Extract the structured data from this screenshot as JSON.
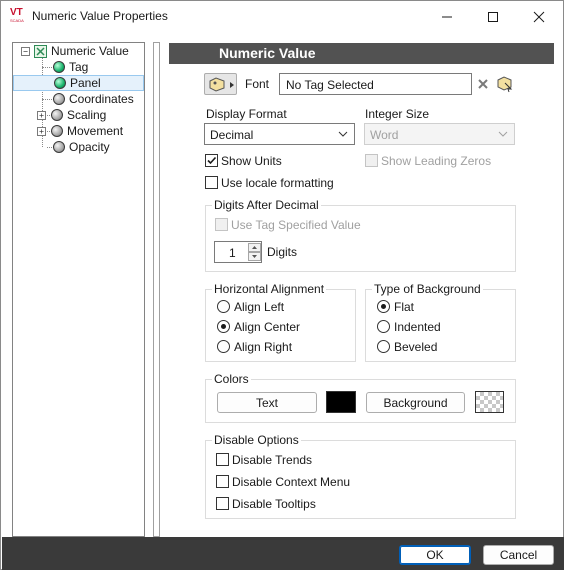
{
  "window": {
    "title": "Numeric Value Properties",
    "logo_text": "VT",
    "logo_subtext": "SCADA"
  },
  "tree": {
    "items": [
      {
        "label": "Numeric Value",
        "icon": "root-properties-icon",
        "expandable": true
      },
      {
        "label": "Tag",
        "icon": "green-ball-icon"
      },
      {
        "label": "Panel",
        "icon": "green-ball-icon",
        "selected": true
      },
      {
        "label": "Coordinates",
        "icon": "gray-ball-icon"
      },
      {
        "label": "Scaling",
        "icon": "gray-ball-icon",
        "expandable": true
      },
      {
        "label": "Movement",
        "icon": "gray-ball-icon",
        "expandable": true
      },
      {
        "label": "Opacity",
        "icon": "gray-ball-icon"
      }
    ]
  },
  "panel": {
    "header": "Numeric Value",
    "font_label": "Font",
    "font_value": "No Tag Selected",
    "display_format": {
      "label": "Display Format",
      "value": "Decimal"
    },
    "integer_size": {
      "label": "Integer Size",
      "value": "Word"
    },
    "show_units": {
      "label": "Show Units",
      "checked": true
    },
    "show_leading_zeros": {
      "label": "Show Leading Zeros",
      "checked": false
    },
    "use_locale": {
      "label": "Use locale formatting",
      "checked": false
    },
    "digits_after_decimal": {
      "title": "Digits After Decimal",
      "use_tag_value": "Use Tag Specified Value",
      "digits_value": "1",
      "digits_label": "Digits"
    },
    "horizontal_alignment": {
      "title": "Horizontal Alignment",
      "options": [
        "Align Left",
        "Align Center",
        "Align Right"
      ],
      "selected": "Align Center"
    },
    "type_of_background": {
      "title": "Type of Background",
      "options": [
        "Flat",
        "Indented",
        "Beveled"
      ],
      "selected": "Flat"
    },
    "colors": {
      "title": "Colors",
      "text_button": "Text",
      "text_color": "#000000",
      "background_button": "Background",
      "background_color": "transparent"
    },
    "disable_options": {
      "title": "Disable Options",
      "items": [
        "Disable Trends",
        "Disable Context Menu",
        "Disable Tooltips"
      ]
    }
  },
  "footer": {
    "ok_label": "OK",
    "cancel_label": "Cancel"
  }
}
